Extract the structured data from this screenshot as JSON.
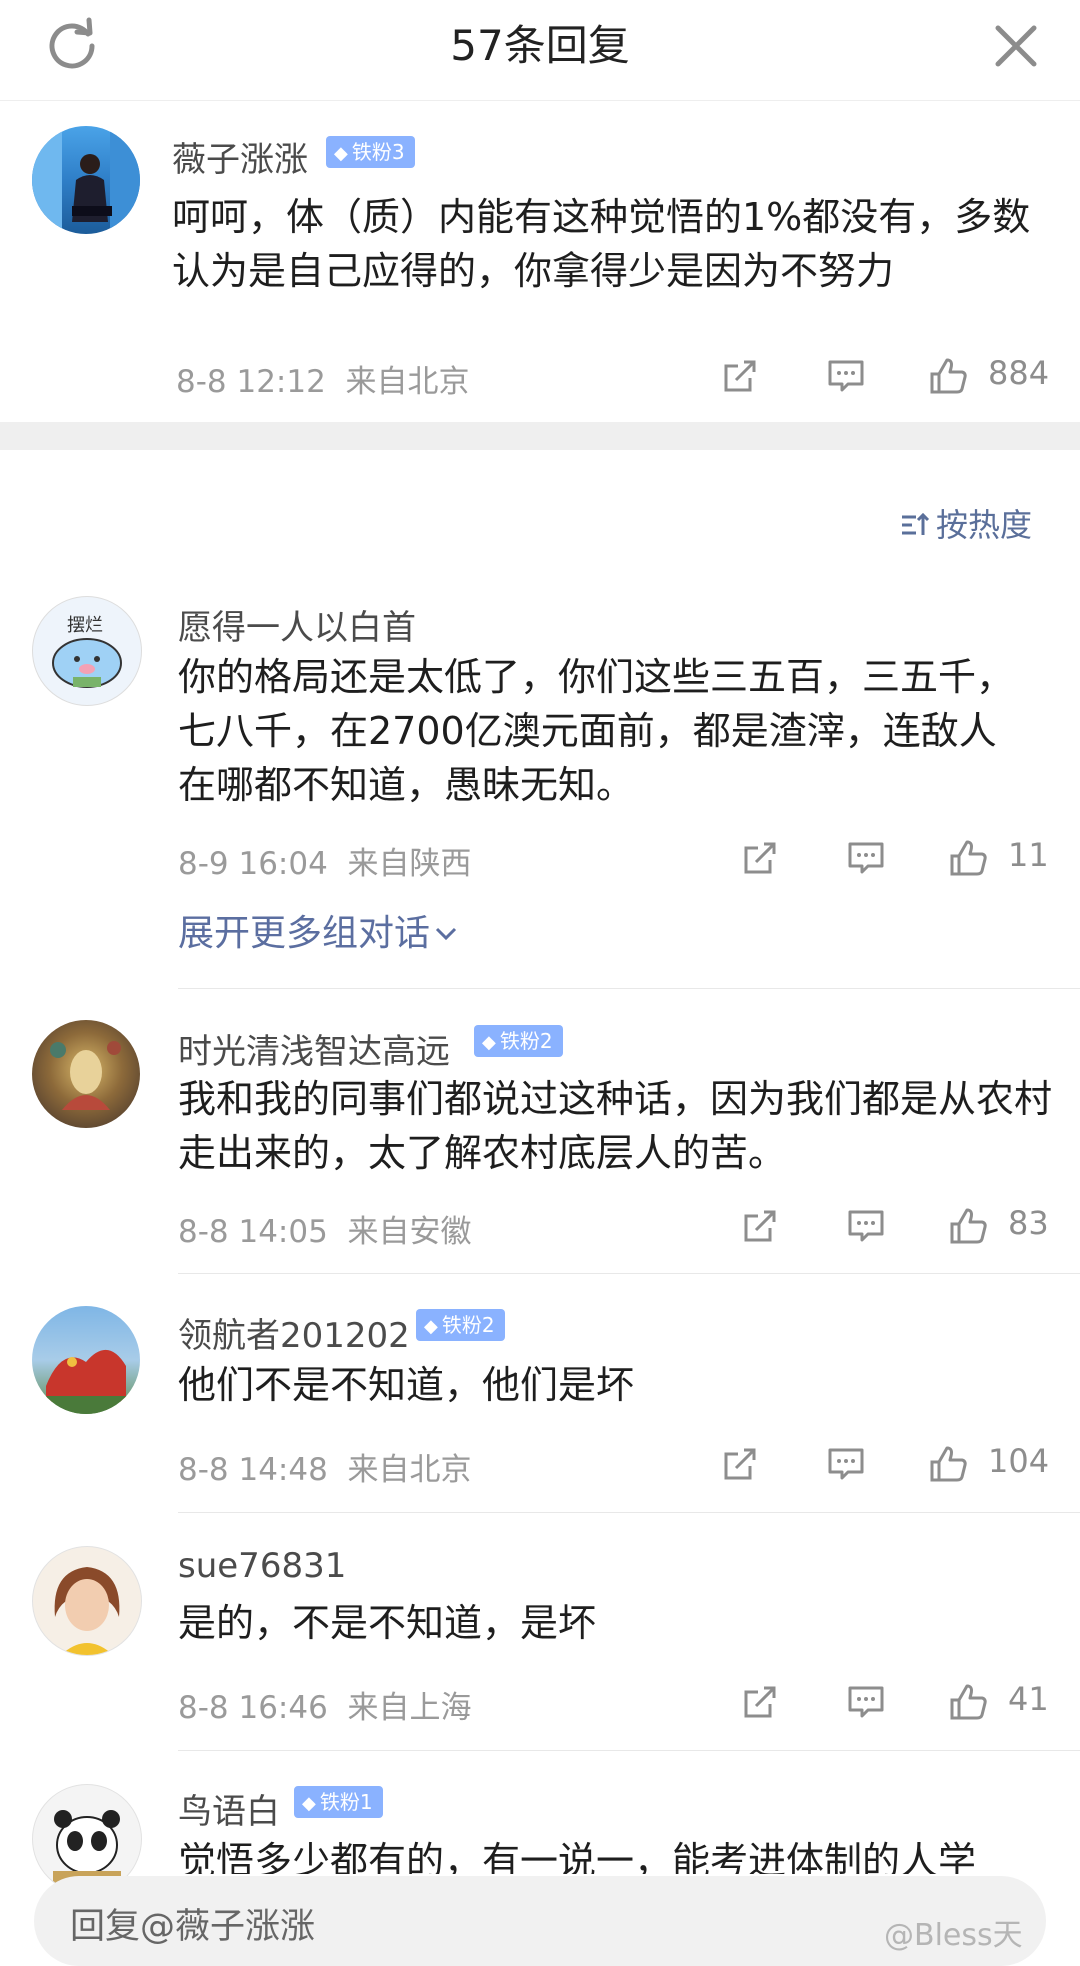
{
  "header": {
    "title": "57条回复"
  },
  "main_comment": {
    "user": "薇子涨涨",
    "badge": "铁粉3",
    "content": "呵呵，体（质）内能有这种觉悟的1%都没有，多数认为是自己应得的，你拿得少是因为不努力",
    "time": "8-8 12:12",
    "location": "来自北京",
    "likes": "884"
  },
  "sort": {
    "label": "按热度"
  },
  "replies": [
    {
      "user": "愿得一人以白首",
      "badge": "",
      "content": "你的格局还是太低了，你们这些三五百，三五千，七八千，在2700亿澳元面前，都是渣滓，连敌人在哪都不知道，愚昧无知。",
      "time": "8-9 16:04",
      "location": "来自陕西",
      "likes": "11",
      "expand": "展开更多组对话"
    },
    {
      "user": "时光清浅智达高远",
      "badge": "铁粉2",
      "content": "我和我的同事们都说过这种话，因为我们都是从农村走出来的，太了解农村底层人的苦。",
      "time": "8-8 14:05",
      "location": "来自安徽",
      "likes": "83"
    },
    {
      "user": "领航者201202",
      "badge": "铁粉2",
      "content": "他们不是不知道，他们是坏",
      "time": "8-8 14:48",
      "location": "来自北京",
      "likes": "104"
    },
    {
      "user": "sue76831",
      "badge": "",
      "content": "是的，不是不知道，是坏",
      "time": "8-8 16:46",
      "location": "来自上海",
      "likes": "41"
    },
    {
      "user": "鸟语白",
      "badge": "铁粉1",
      "content": "觉悟多少都有的，有一说一，能考进体制的人学"
    }
  ],
  "reply_bar": {
    "placeholder": "回复@薇子涨涨"
  },
  "watermark": "@Bless天",
  "icons": {
    "refresh": "refresh-icon",
    "close": "close-icon",
    "share": "share-icon",
    "comment": "comment-icon",
    "like": "thumbs-up-icon",
    "badge": "diamond-icon",
    "sort": "sort-icon",
    "expand": "chevron-down-icon"
  },
  "colors": {
    "badge": "#8ab2ff",
    "link": "#5b6ea0",
    "meta": "#9a9a9a"
  }
}
